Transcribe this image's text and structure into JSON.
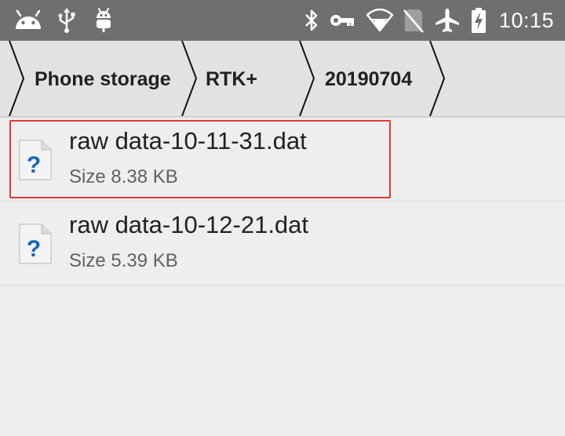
{
  "status_bar": {
    "time": "10:15",
    "icons": [
      "android-icon",
      "usb-icon",
      "android-debug-icon",
      "bluetooth-icon",
      "vpn-key-icon",
      "wifi-icon",
      "no-sim-icon",
      "airplane-icon",
      "battery-charging-icon"
    ]
  },
  "breadcrumb": {
    "items": [
      {
        "label": "Phone storage"
      },
      {
        "label": "RTK+"
      },
      {
        "label": "20190704"
      }
    ]
  },
  "files": [
    {
      "name": "raw data-10-11-31.dat",
      "size": "Size 8.38 KB",
      "icon": "unknown-file-icon",
      "selected": true
    },
    {
      "name": "raw data-10-12-21.dat",
      "size": "Size 5.39 KB",
      "icon": "unknown-file-icon",
      "selected": false
    }
  ],
  "colors": {
    "status_bar": "#6f6f6f",
    "breadcrumb_bar": "#e2e2e2",
    "background": "#eeeeee",
    "highlight": "#e53935",
    "icon_blue": "#1565c0"
  }
}
